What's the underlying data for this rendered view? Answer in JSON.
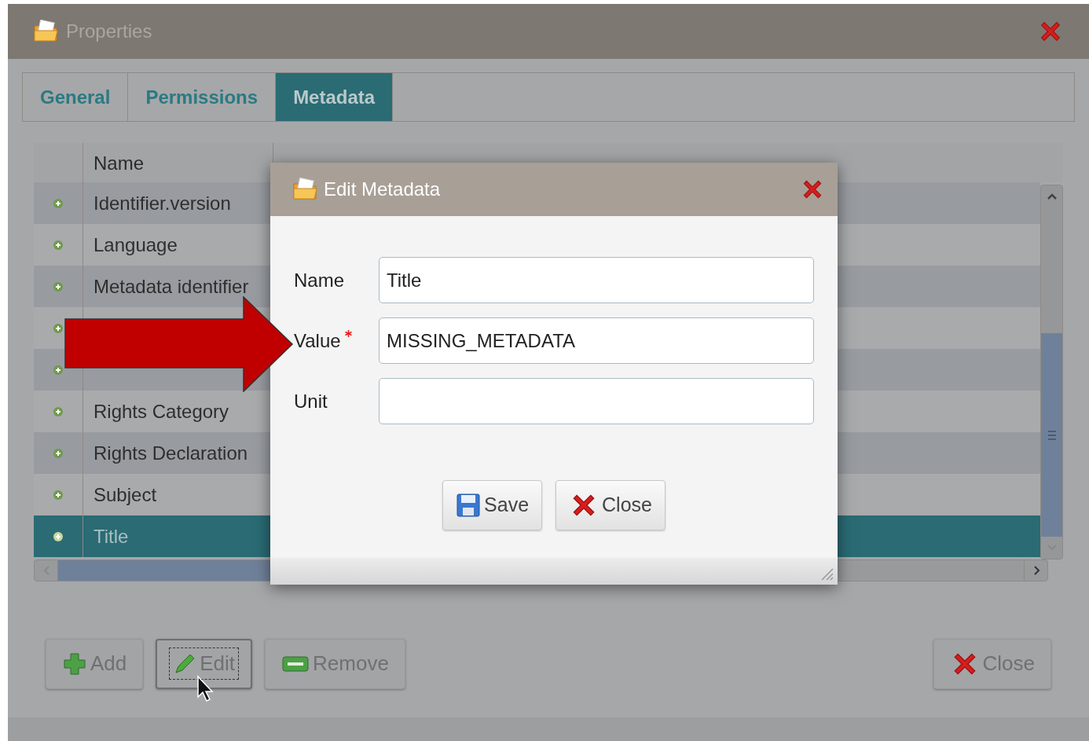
{
  "window": {
    "title": "Properties"
  },
  "tabs": [
    {
      "label": "General",
      "selected": false
    },
    {
      "label": "Permissions",
      "selected": false
    },
    {
      "label": "Metadata",
      "selected": true
    }
  ],
  "table": {
    "columns": [
      "Name"
    ],
    "rows": [
      {
        "name": "Identifier.version",
        "selected": false
      },
      {
        "name": "Language",
        "selected": false
      },
      {
        "name": "Metadata identifier",
        "selected": false
      },
      {
        "selected": false
      },
      {
        "selected": false
      },
      {
        "name": "Rights Category",
        "selected": false
      },
      {
        "name": "Rights Declaration",
        "selected": false
      },
      {
        "name": "Subject",
        "selected": false
      },
      {
        "name": "Title",
        "selected": true
      }
    ]
  },
  "buttons": [
    {
      "label": "Add",
      "kind": "add",
      "focused": false
    },
    {
      "label": "Edit",
      "kind": "edit",
      "focused": true
    },
    {
      "label": "Remove",
      "kind": "remove",
      "focused": false
    },
    {
      "label": "Close",
      "kind": "close",
      "focused": false
    }
  ],
  "dialog": {
    "title": "Edit Metadata",
    "fields": [
      {
        "label": "Name",
        "value": "Title",
        "required": false
      },
      {
        "label": "Value",
        "value": "MISSING_METADATA",
        "required": true
      },
      {
        "label": "Unit",
        "required": false
      }
    ],
    "buttons": [
      {
        "label": "Save",
        "kind": "save"
      },
      {
        "label": "Close",
        "kind": "close"
      }
    ]
  }
}
